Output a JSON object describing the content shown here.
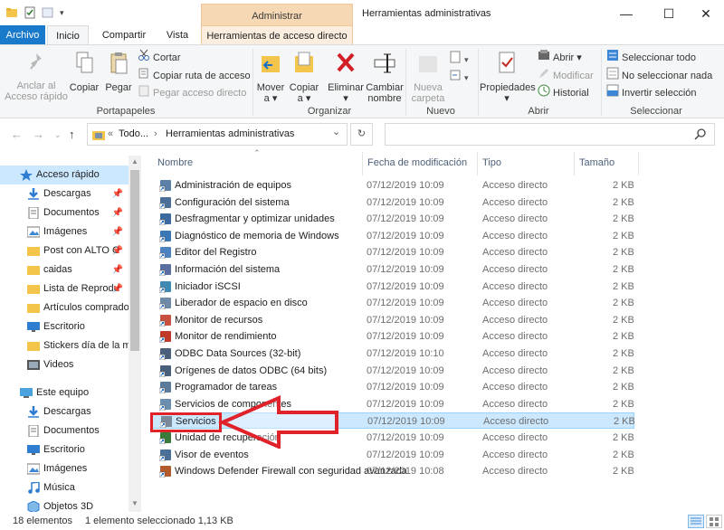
{
  "window": {
    "title": "Herramientas administrativas",
    "context_header": "Administrar",
    "controls": {
      "minimize": "—",
      "maximize": "☐",
      "close": "✕"
    }
  },
  "tabs": [
    {
      "label": "Archivo"
    },
    {
      "label": "Inicio"
    },
    {
      "label": "Compartir"
    },
    {
      "label": "Vista"
    },
    {
      "label": "Herramientas de acceso directo"
    }
  ],
  "ribbon": {
    "portapapeles": {
      "label": "Portapapeles",
      "anclar": "Anclar al\nAcceso rápido",
      "anclar_1": "Anclar al",
      "anclar_2": "Acceso rápido",
      "copiar": "Copiar",
      "pegar": "Pegar",
      "cortar": "Cortar",
      "copiar_ruta": "Copiar ruta de acceso",
      "pegar_acceso": "Pegar acceso directo"
    },
    "organizar": {
      "label": "Organizar",
      "mover_1": "Mover",
      "mover_2": "a ▾",
      "copiar_1": "Copiar",
      "copiar_2": "a ▾",
      "eliminar_1": "Eliminar",
      "eliminar_2": "▾",
      "cambiar_1": "Cambiar",
      "cambiar_2": "nombre"
    },
    "nuevo": {
      "label": "Nuevo",
      "nueva_1": "Nueva",
      "nueva_2": "carpeta"
    },
    "abrir": {
      "label": "Abrir",
      "propiedades_1": "Propiedades",
      "propiedades_2": "▾",
      "abrir": "Abrir ▾",
      "modificar": "Modificar",
      "historial": "Historial"
    },
    "seleccionar": {
      "label": "Seleccionar",
      "todo": "Seleccionar todo",
      "ninguno": "No seleccionar nada",
      "invertir": "Invertir selección"
    }
  },
  "address": {
    "crumb_prefix": "«",
    "crumb_1": "Todo...",
    "sep": "›",
    "crumb_2": "Herramientas administrativas",
    "dropdown": "⌄",
    "refresh": "↻",
    "search_icon": "search-icon"
  },
  "nav": [
    {
      "label": "Acceso rápido",
      "icon": "star-icon",
      "selected": true
    },
    {
      "label": "Descargas",
      "icon": "download-icon",
      "pinned": true
    },
    {
      "label": "Documentos",
      "icon": "document-icon",
      "pinned": true
    },
    {
      "label": "Imágenes",
      "icon": "image-icon",
      "pinned": true
    },
    {
      "label": "Post con ALTO C",
      "icon": "folder-icon",
      "pinned": true
    },
    {
      "label": "caidas",
      "icon": "folder-icon",
      "pinned": true
    },
    {
      "label": "Lista de Reprodu",
      "icon": "folder-icon",
      "pinned": true
    },
    {
      "label": "Artículos comprado",
      "icon": "folder-icon"
    },
    {
      "label": "Escritorio",
      "icon": "desktop-icon"
    },
    {
      "label": "Stickers día de la mu",
      "icon": "folder-icon"
    },
    {
      "label": "Videos",
      "icon": "video-icon"
    },
    {
      "label": "Este equipo",
      "icon": "computer-icon"
    },
    {
      "label": "Descargas",
      "icon": "download-icon"
    },
    {
      "label": "Documentos",
      "icon": "document-icon"
    },
    {
      "label": "Escritorio",
      "icon": "desktop-icon"
    },
    {
      "label": "Imágenes",
      "icon": "image-icon"
    },
    {
      "label": "Música",
      "icon": "music-icon"
    },
    {
      "label": "Objetos 3D",
      "icon": "cube-icon"
    }
  ],
  "columns": {
    "name": "Nombre",
    "date": "Fecha de modificación",
    "type": "Tipo",
    "size": "Tamaño"
  },
  "files": [
    {
      "name": "Administración de equipos",
      "date": "07/12/2019 10:09",
      "type": "Acceso directo",
      "size": "2 KB"
    },
    {
      "name": "Configuración del sistema",
      "date": "07/12/2019 10:09",
      "type": "Acceso directo",
      "size": "2 KB"
    },
    {
      "name": "Desfragmentar y optimizar unidades",
      "date": "07/12/2019 10:09",
      "type": "Acceso directo",
      "size": "2 KB"
    },
    {
      "name": "Diagnóstico de memoria de Windows",
      "date": "07/12/2019 10:09",
      "type": "Acceso directo",
      "size": "2 KB"
    },
    {
      "name": "Editor del Registro",
      "date": "07/12/2019 10:09",
      "type": "Acceso directo",
      "size": "2 KB"
    },
    {
      "name": "Información del sistema",
      "date": "07/12/2019 10:09",
      "type": "Acceso directo",
      "size": "2 KB"
    },
    {
      "name": "Iniciador iSCSI",
      "date": "07/12/2019 10:09",
      "type": "Acceso directo",
      "size": "2 KB"
    },
    {
      "name": "Liberador de espacio en disco",
      "date": "07/12/2019 10:09",
      "type": "Acceso directo",
      "size": "2 KB"
    },
    {
      "name": "Monitor de recursos",
      "date": "07/12/2019 10:09",
      "type": "Acceso directo",
      "size": "2 KB"
    },
    {
      "name": "Monitor de rendimiento",
      "date": "07/12/2019 10:09",
      "type": "Acceso directo",
      "size": "2 KB"
    },
    {
      "name": "ODBC Data Sources (32-bit)",
      "date": "07/12/2019 10:10",
      "type": "Acceso directo",
      "size": "2 KB"
    },
    {
      "name": "Orígenes de datos ODBC (64 bits)",
      "date": "07/12/2019 10:09",
      "type": "Acceso directo",
      "size": "2 KB"
    },
    {
      "name": "Programador de tareas",
      "date": "07/12/2019 10:09",
      "type": "Acceso directo",
      "size": "2 KB"
    },
    {
      "name": "Servicios de componentes",
      "date": "07/12/2019 10:09",
      "type": "Acceso directo",
      "size": "2 KB"
    },
    {
      "name": "Servicios",
      "date": "07/12/2019 10:09",
      "type": "Acceso directo",
      "size": "2 KB",
      "selected": true
    },
    {
      "name": "Unidad de recuperación",
      "date": "07/12/2019 10:09",
      "type": "Acceso directo",
      "size": "2 KB"
    },
    {
      "name": "Visor de eventos",
      "date": "07/12/2019 10:09",
      "type": "Acceso directo",
      "size": "2 KB"
    },
    {
      "name": "Windows Defender Firewall con seguridad avanzada",
      "date": "07/12/2019 10:08",
      "type": "Acceso directo",
      "size": "2 KB"
    }
  ],
  "status": {
    "count": "18 elementos",
    "selection": "1 elemento seleccionado  1,13 KB"
  },
  "colors": {
    "file_tab": "#1979ca",
    "context_tab": "#f6d8b5",
    "selection": "#cce8ff",
    "annotation": "#e0222a"
  }
}
